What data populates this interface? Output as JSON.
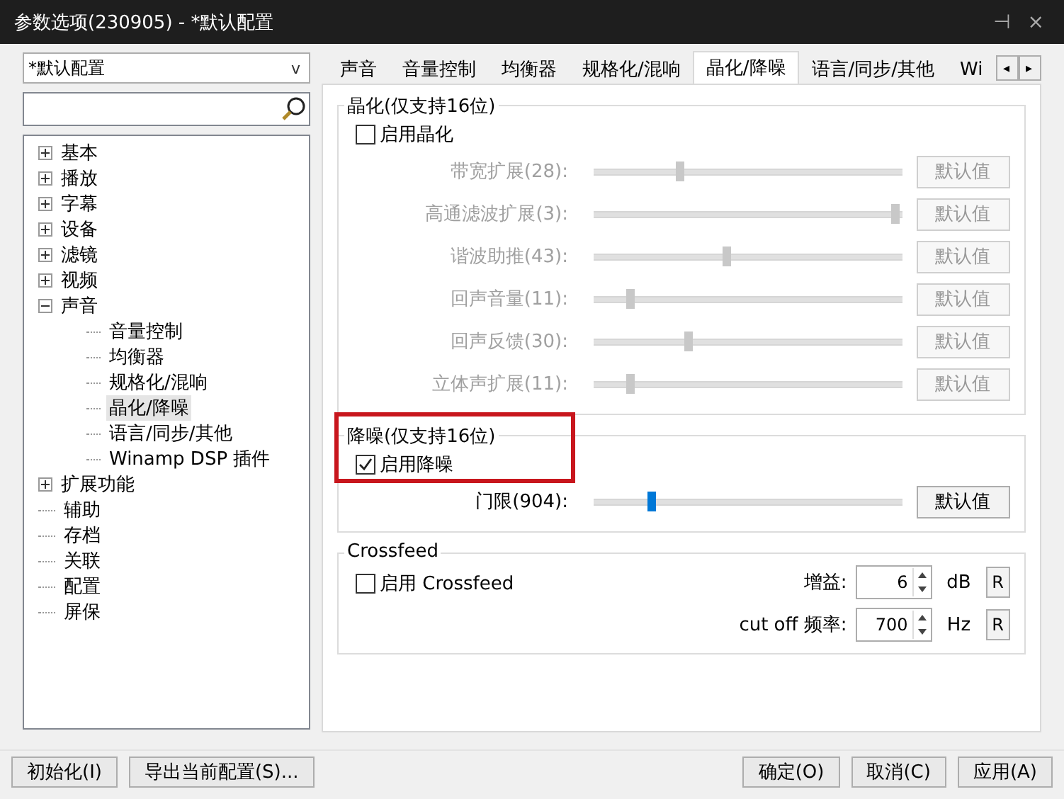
{
  "window": {
    "title": "参数选项(230905) - *默认配置",
    "buttons": [
      "⊣",
      "×"
    ]
  },
  "profile": {
    "value": "*默认配置",
    "caret": "v"
  },
  "tree": [
    {
      "label": "基本",
      "expanded": false,
      "selected": false
    },
    {
      "label": "播放",
      "expanded": false,
      "selected": false
    },
    {
      "label": "字幕",
      "expanded": false,
      "selected": false
    },
    {
      "label": "设备",
      "expanded": false,
      "selected": false
    },
    {
      "label": "滤镜",
      "expanded": false,
      "selected": false
    },
    {
      "label": "视频",
      "expanded": false,
      "selected": false
    },
    {
      "label": "声音",
      "expanded": true,
      "selected": false,
      "children": [
        {
          "label": "音量控制",
          "selected": false
        },
        {
          "label": "均衡器",
          "selected": false
        },
        {
          "label": "规格化/混响",
          "selected": false
        },
        {
          "label": "晶化/降噪",
          "selected": true
        },
        {
          "label": "语言/同步/其他",
          "selected": false
        },
        {
          "label": "Winamp DSP 插件",
          "selected": false
        }
      ]
    },
    {
      "label": "扩展功能",
      "expanded": false,
      "selected": false
    },
    {
      "label": "辅助",
      "selected": false
    },
    {
      "label": "存档",
      "selected": false
    },
    {
      "label": "关联",
      "selected": false
    },
    {
      "label": "配置",
      "selected": false
    },
    {
      "label": "屏保",
      "selected": false
    }
  ],
  "tabs": [
    {
      "label": "声音",
      "selected": false
    },
    {
      "label": "音量控制",
      "selected": false
    },
    {
      "label": "均衡器",
      "selected": false
    },
    {
      "label": "规格化/混响",
      "selected": false
    },
    {
      "label": "晶化/降噪",
      "selected": true
    },
    {
      "label": "语言/同步/其他",
      "selected": false
    },
    {
      "label": "Wi",
      "selected": false
    }
  ],
  "tab_scroll": [
    "◂",
    "▸"
  ],
  "crystal": {
    "title": "晶化(仅支持16位)",
    "enable": {
      "label": "启用晶化",
      "checked": false
    },
    "sliders": [
      {
        "label": "带宽扩展(28):",
        "level": 0.28,
        "disabled": true,
        "button": "默认值"
      },
      {
        "label": "高通滤波扩展(3):",
        "level": 0.98,
        "disabled": true,
        "button": "默认值"
      },
      {
        "label": "谐波助推(43):",
        "level": 0.43,
        "disabled": true,
        "button": "默认值"
      },
      {
        "label": "回声音量(11):",
        "level": 0.12,
        "disabled": true,
        "button": "默认值"
      },
      {
        "label": "回声反馈(30):",
        "level": 0.31,
        "disabled": true,
        "button": "默认值"
      },
      {
        "label": "立体声扩展(11):",
        "level": 0.12,
        "disabled": true,
        "button": "默认值"
      }
    ]
  },
  "denoise": {
    "title": "降噪(仅支持16位)",
    "enable": {
      "label": "启用降噪",
      "checked": true
    },
    "sliders": [
      {
        "label": "门限(904):",
        "level": 0.19,
        "disabled": false,
        "button": "默认值"
      }
    ]
  },
  "crossfeed": {
    "title": "Crossfeed",
    "enable": {
      "label": "启用 Crossfeed",
      "checked": false
    },
    "fields": [
      {
        "label": "增益:",
        "value": "6",
        "unit": "dB",
        "reset": "R"
      },
      {
        "label": "cut off 频率:",
        "value": "700",
        "unit": "Hz",
        "reset": "R"
      }
    ]
  },
  "footer": {
    "left": [
      "初始化(I)",
      "导出当前配置(S)..."
    ],
    "right": [
      "确定(O)",
      "取消(C)",
      "应用(A)"
    ]
  }
}
